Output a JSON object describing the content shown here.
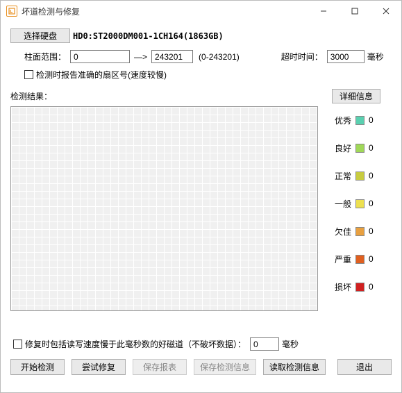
{
  "window": {
    "title": "坏道检测与修复"
  },
  "disk": {
    "select_btn": "选择硬盘",
    "name": "HD0:ST2000DM001-1CH164(1863GB)"
  },
  "cylinder": {
    "label": "柱面范围：",
    "start": "0",
    "end": "243201",
    "arrow": "—>",
    "range_hint": "(0-243201)"
  },
  "timeout": {
    "label": "超时时间：",
    "value": "3000",
    "unit": "毫秒"
  },
  "check_accurate": {
    "label": "检测时报告准确的扇区号(速度较慢)"
  },
  "result": {
    "label": "检测结果：",
    "detail_btn": "详细信息"
  },
  "legend": [
    {
      "label": "优秀",
      "count": "0"
    },
    {
      "label": "良好",
      "count": "0"
    },
    {
      "label": "正常",
      "count": "0"
    },
    {
      "label": "一般",
      "count": "0"
    },
    {
      "label": "欠佳",
      "count": "0"
    },
    {
      "label": "严重",
      "count": "0"
    },
    {
      "label": "损坏",
      "count": "0"
    }
  ],
  "repair": {
    "label": "修复时包括读写速度慢于此毫秒数的好磁道（不破坏数据）：",
    "value": "0",
    "unit": "毫秒"
  },
  "buttons": {
    "start": "开始检测",
    "try_repair": "尝试修复",
    "save_report": "保存报表",
    "save_info": "保存检测信息",
    "load_info": "读取检测信息",
    "exit": "退出"
  }
}
